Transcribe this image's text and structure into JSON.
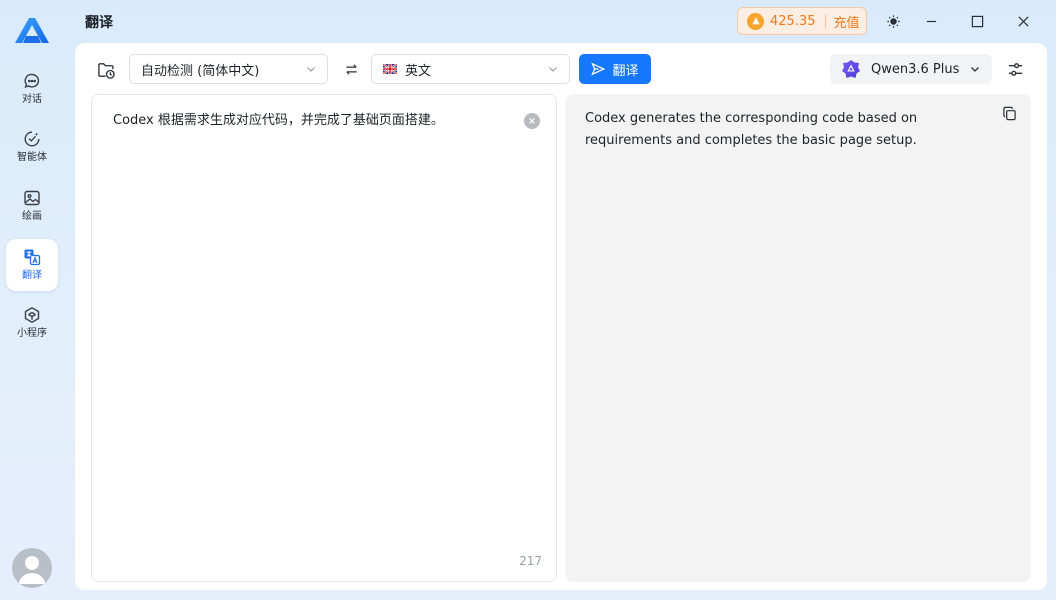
{
  "app": {
    "title": "翻译",
    "points": "425.35",
    "recharge_label": "充值"
  },
  "sidebar": {
    "items": [
      {
        "label": "对话",
        "icon": "chat-bubble-icon"
      },
      {
        "label": "智能体",
        "icon": "agent-icon"
      },
      {
        "label": "绘画",
        "icon": "image-icon"
      },
      {
        "label": "翻译",
        "icon": "translate-icon",
        "active": true
      },
      {
        "label": "小程序",
        "icon": "mini-program-icon"
      }
    ]
  },
  "toolbar": {
    "source_lang": "自动检测 (简体中文)",
    "target_lang": "英文",
    "translate_label": "翻译",
    "model_name": "Qwen3.6 Plus"
  },
  "source": {
    "text": "Codex 根据需求生成对应代码，并完成了基础页面搭建。",
    "char_count": "217"
  },
  "result": {
    "text": "Codex generates the corresponding code based on requirements and completes the basic page setup."
  },
  "colors": {
    "accent": "#1677ff",
    "points": "#f07a1b",
    "result_bg": "#f3f3f4"
  }
}
